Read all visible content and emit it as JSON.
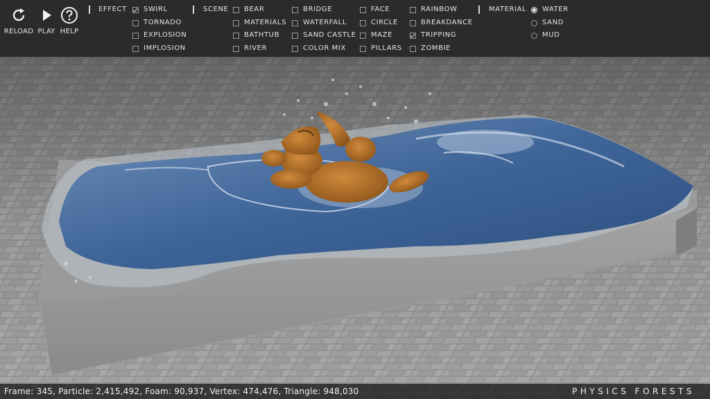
{
  "toolbar": {
    "buttons": [
      {
        "label": "RELOAD",
        "icon": "reload-icon"
      },
      {
        "label": "PLAY",
        "icon": "play-icon"
      },
      {
        "label": "HELP",
        "icon": "help-icon"
      }
    ],
    "effect": {
      "label": "EFFECT",
      "options": [
        {
          "label": "SWIRL",
          "checked": true
        },
        {
          "label": "TORNADO",
          "checked": false
        },
        {
          "label": "EXPLOSION",
          "checked": false
        },
        {
          "label": "IMPLOSION",
          "checked": false
        }
      ]
    },
    "scene": {
      "label": "SCENE",
      "col1": [
        {
          "label": "BEAR",
          "checked": false
        },
        {
          "label": "MATERIALS",
          "checked": false
        },
        {
          "label": "BATHTUB",
          "checked": false
        },
        {
          "label": "RIVER",
          "checked": false
        }
      ],
      "col2": [
        {
          "label": "BRIDGE",
          "checked": false
        },
        {
          "label": "WATERFALL",
          "checked": false
        },
        {
          "label": "SAND CASTLE",
          "checked": false
        },
        {
          "label": "COLOR MIX",
          "checked": false
        }
      ],
      "col3": [
        {
          "label": "FACE",
          "checked": false
        },
        {
          "label": "CIRCLE",
          "checked": false
        },
        {
          "label": "MAZE",
          "checked": false
        },
        {
          "label": "PILLARS",
          "checked": false
        }
      ],
      "col4": [
        {
          "label": "RAINBOW",
          "checked": false
        },
        {
          "label": "BREAKDANCE",
          "checked": false
        },
        {
          "label": "TRIPPING",
          "checked": true
        },
        {
          "label": "ZOMBIE",
          "checked": false
        }
      ]
    },
    "material": {
      "label": "MATERIAL",
      "options": [
        {
          "label": "WATER",
          "selected": true
        },
        {
          "label": "SAND",
          "selected": false
        },
        {
          "label": "MUD",
          "selected": false
        }
      ]
    }
  },
  "status": {
    "stats": "Frame: 345, Particle: 2,415,492, Foam: 90,937, Vertex: 474,476, Triangle: 948,030",
    "brand": "PHYSICS FORESTS"
  },
  "colors": {
    "toolbar_bg": "#282828",
    "water": "#3f6a9e",
    "bear": "#b8742a",
    "container": "#8c8c8c"
  }
}
